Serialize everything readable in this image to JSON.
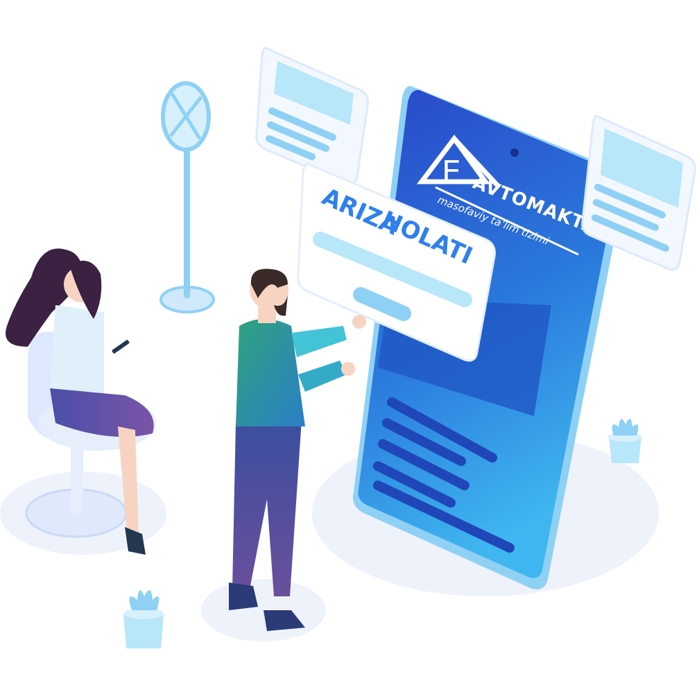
{
  "logo": {
    "letter": "E",
    "name": "AVTOMAKTAB",
    "tagline": "masofaviy ta’lim tizimi"
  },
  "status_card": {
    "title_line1": "ARIZA",
    "title_line2": "HOLATI"
  },
  "icons": {
    "phone": "smartphone-icon",
    "sign": "road-sign-icon",
    "plant": "plant-icon"
  }
}
